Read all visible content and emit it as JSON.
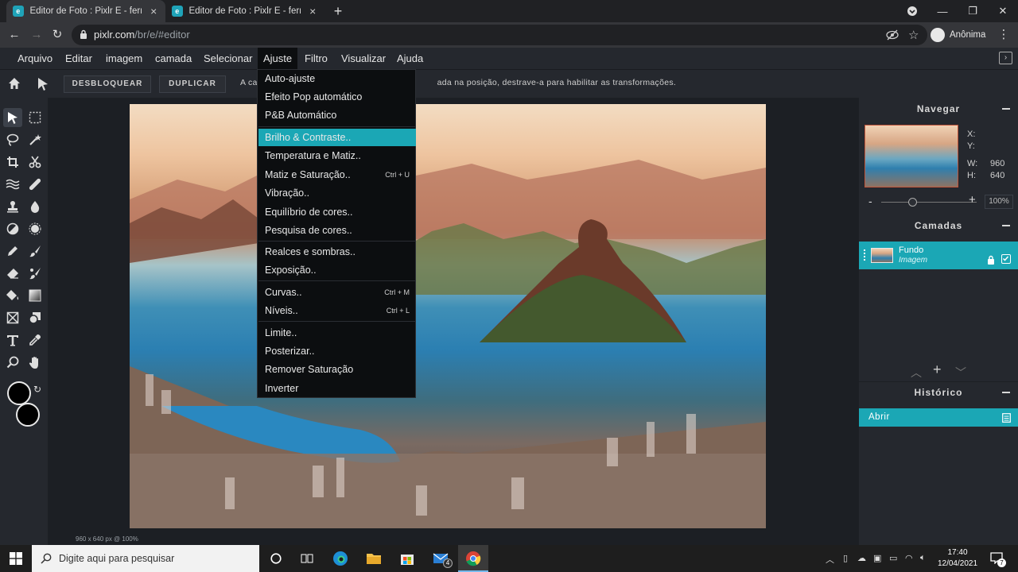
{
  "browser": {
    "tabs": [
      {
        "title": "Editor de Foto : Pixlr E - ferramen",
        "active": true
      },
      {
        "title": "Editor de Foto : Pixlr E - ferramen",
        "active": false
      }
    ],
    "url_host": "pixlr.com",
    "url_path": "/br/e/#editor",
    "profile_label": "Anônima",
    "new_tab": "+",
    "controls": {
      "minimize": "—",
      "maximize": "❐",
      "close": "✕"
    }
  },
  "app": {
    "menu": [
      "Arquivo",
      "Editar",
      "imagem",
      "camada",
      "Selecionar",
      "Ajuste",
      "Filtro",
      "Visualizar",
      "Ajuda"
    ],
    "open_menu": "Ajuste",
    "options": {
      "unlock": "DESBLOQUEAR",
      "duplicate": "DUPLICAR",
      "hint_start": "A ca",
      "hint_end": "ada na posição, destrave-a para habilitar as transformações."
    },
    "dropdown": [
      {
        "label": "Auto-ajuste",
        "shortcut": ""
      },
      {
        "label": "Efeito Pop automático",
        "shortcut": ""
      },
      {
        "label": "P&B Automático",
        "shortcut": ""
      },
      {
        "label": "Brilho & Contraste..",
        "shortcut": "",
        "highlight": true
      },
      {
        "label": "Temperatura e Matiz..",
        "shortcut": ""
      },
      {
        "label": "Matiz e Saturação..",
        "shortcut": "Ctrl + U"
      },
      {
        "label": "Vibração..",
        "shortcut": ""
      },
      {
        "label": "Equilíbrio de cores..",
        "shortcut": ""
      },
      {
        "label": "Pesquisa de cores..",
        "shortcut": ""
      },
      {
        "label": "Realces e sombras..",
        "shortcut": ""
      },
      {
        "label": "Exposição..",
        "shortcut": ""
      },
      {
        "label": "Curvas..",
        "shortcut": "Ctrl + M"
      },
      {
        "label": "Níveis..",
        "shortcut": "Ctrl + L"
      },
      {
        "label": "Limite..",
        "shortcut": ""
      },
      {
        "label": "Posterizar..",
        "shortcut": ""
      },
      {
        "label": "Remover Saturação",
        "shortcut": ""
      },
      {
        "label": "Inverter",
        "shortcut": ""
      }
    ],
    "status": "960 x 640 px @ 100%",
    "navigator": {
      "title": "Navegar",
      "x_label": "X:",
      "y_label": "Y:",
      "w_label": "W:",
      "w_value": "960",
      "h_label": "H:",
      "h_value": "640",
      "zoom": "100%"
    },
    "layers": {
      "title": "Camadas",
      "items": [
        {
          "name": "Fundo",
          "sub": "Imagem"
        }
      ]
    },
    "history": {
      "title": "Histórico",
      "items": [
        "Abrir"
      ]
    },
    "colors": {
      "accent": "#1ba7b5",
      "foreground": "#000000",
      "background": "#000000"
    }
  },
  "taskbar": {
    "search_placeholder": "Digite aqui para pesquisar",
    "time": "17:40",
    "date": "12/04/2021",
    "mail_badge": "4",
    "notif_badge": "7"
  }
}
